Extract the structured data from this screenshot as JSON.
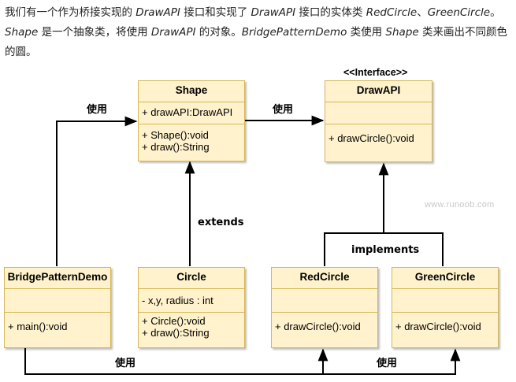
{
  "intro": {
    "p1": "我们有一个作为桥接实现的 ",
    "p2": "DrawAPI",
    "p3": " 接口和实现了 ",
    "p4": "DrawAPI",
    "p5": " 接口的实体类 ",
    "p6": "RedCircle",
    "p7": "、",
    "p8": "GreenCircle",
    "p9": "。",
    "p10": "Shape",
    "p11": " 是一个抽象类，将使用 ",
    "p12": "DrawAPI",
    "p13": " 的对象。",
    "p14": "BridgePatternDemo",
    "p15": " 类使用 ",
    "p16": "Shape",
    "p17": " 类来画出不同颜色的圆。"
  },
  "classes": {
    "shape": {
      "name": "Shape",
      "fields": [
        "+ drawAPI:DrawAPI"
      ],
      "methods": [
        "+ Shape():void",
        "+ draw():String"
      ]
    },
    "drawapi": {
      "stereotype": "<<Interface>>",
      "name": "DrawAPI",
      "fields": [],
      "methods": [
        "+ drawCircle():void"
      ]
    },
    "demo": {
      "name": "BridgePatternDemo",
      "fields": [],
      "methods": [
        "+ main():void"
      ]
    },
    "circle": {
      "name": "Circle",
      "fields": [
        "- x,y, radius : int"
      ],
      "methods": [
        "+ Circle():void",
        "+ draw():String"
      ]
    },
    "red": {
      "name": "RedCircle",
      "fields": [],
      "methods": [
        "+ drawCircle():void"
      ]
    },
    "green": {
      "name": "GreenCircle",
      "fields": [],
      "methods": [
        "+ drawCircle():void"
      ]
    }
  },
  "labels": {
    "use1": "使用",
    "use2": "使用",
    "extends": "extends",
    "implements": "implements",
    "use3": "使用",
    "use4": "使用"
  },
  "watermark": "www.runoob.com",
  "colors": {
    "box_fill": "#fff2cc",
    "box_border": "#d6b656",
    "line": "#000000"
  }
}
